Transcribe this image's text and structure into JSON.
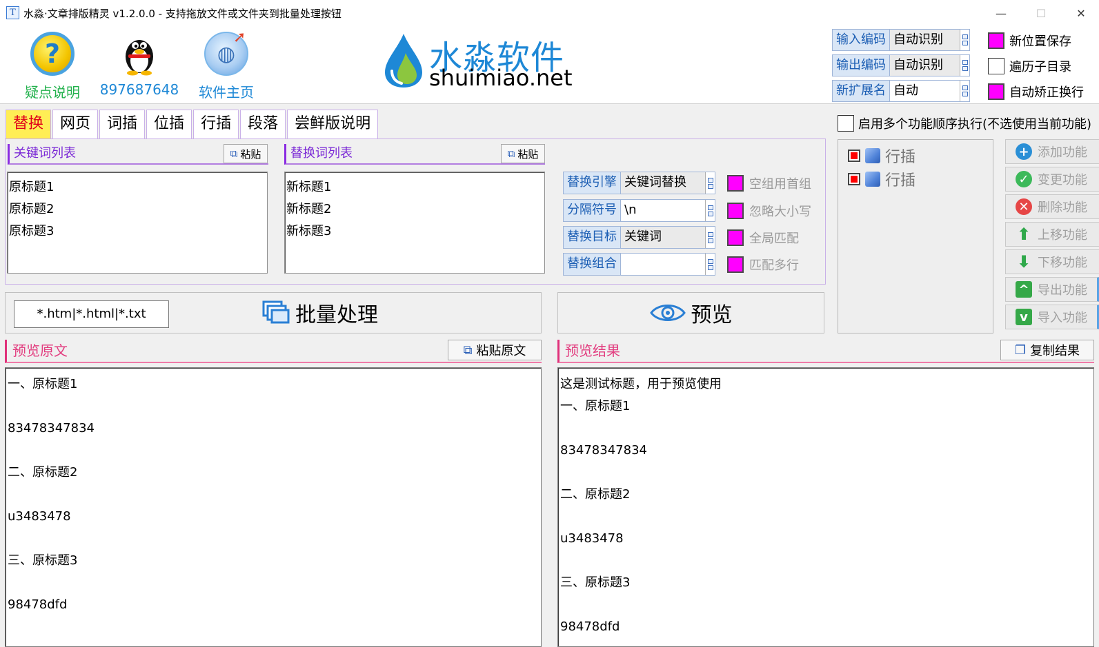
{
  "window": {
    "title": "水淼·文章排版精灵 v1.2.0.0 - 支持拖放文件或文件夹到批量处理按钮",
    "app_icon_char": "T",
    "minimize": "—",
    "maximize": "☐",
    "close": "✕"
  },
  "header": {
    "links": [
      {
        "label": "疑点说明",
        "color": "#22b14c"
      },
      {
        "label": "897687648",
        "color": "#1e88d6"
      },
      {
        "label": "软件主页",
        "color": "#1e88d6"
      }
    ],
    "logo_cn": "水淼软件",
    "logo_en": "shuimiao.net",
    "encodings": [
      {
        "label": "输入编码",
        "value": "自动识别"
      },
      {
        "label": "输出编码",
        "value": "自动识别"
      },
      {
        "label": "新扩展名",
        "value": "自动"
      }
    ],
    "options": [
      {
        "label": "新位置保存",
        "checked": true
      },
      {
        "label": "遍历子目录",
        "checked": false
      },
      {
        "label": "自动矫正换行",
        "checked": true
      }
    ]
  },
  "tabs": [
    "替换",
    "网页",
    "词插",
    "位插",
    "行插",
    "段落",
    "尝鲜版说明"
  ],
  "replace_panel": {
    "keyword_list_title": "关键词列表",
    "replace_list_title": "替换词列表",
    "paste_label": "粘贴",
    "keywords": [
      "原标题1",
      "原标题2",
      "原标题3"
    ],
    "replacements": [
      "新标题1",
      "新标题2",
      "新标题3"
    ],
    "settings": [
      {
        "label": "替换引擎",
        "value": "关键词替换"
      },
      {
        "label": "分隔符号",
        "value": "\\n"
      },
      {
        "label": "替换目标",
        "value": "关键词"
      },
      {
        "label": "替换组合",
        "value": ""
      }
    ],
    "flags": [
      "空组用首组",
      "忽略大小写",
      "全局匹配",
      "匹配多行"
    ]
  },
  "function_panel": {
    "enable_label": "启用多个功能顺序执行(不选使用当前功能)",
    "items": [
      "行插",
      "行插"
    ],
    "buttons": [
      {
        "label": "添加功能",
        "icon": "plus-icon",
        "color": "#2a8fd6",
        "glyph": "+"
      },
      {
        "label": "变更功能",
        "icon": "check-icon",
        "color": "#3cb95a",
        "glyph": "✓"
      },
      {
        "label": "删除功能",
        "icon": "delete-icon",
        "color": "#e64646",
        "glyph": "✕"
      },
      {
        "label": "上移功能",
        "icon": "arrow-up-icon",
        "color": "#2fa84a",
        "glyph": "⬆"
      },
      {
        "label": "下移功能",
        "icon": "arrow-down-icon",
        "color": "#2fa84a",
        "glyph": "⬇"
      },
      {
        "label": "导出功能",
        "icon": "export-icon",
        "color": "#35a848",
        "glyph": "^"
      },
      {
        "label": "导入功能",
        "icon": "import-icon",
        "color": "#35a848",
        "glyph": "v"
      }
    ]
  },
  "batch": {
    "extensions": "*.htm|*.html|*.txt",
    "label": "批量处理"
  },
  "preview_button": "预览",
  "source": {
    "title": "预览原文",
    "paste_label": "粘贴原文",
    "lines": [
      "一、原标题1",
      "",
      "83478347834",
      "",
      "二、原标题2",
      "",
      "u3483478",
      "",
      "三、原标题3",
      "",
      "98478dfd",
      ""
    ]
  },
  "result": {
    "title": "预览结果",
    "copy_label": "复制结果",
    "lines": [
      "这是测试标题，用于预览使用",
      "一、原标题1",
      "",
      "83478347834",
      "",
      "二、原标题2",
      "",
      "u3483478",
      "",
      "三、原标题3",
      "",
      "98478dfd"
    ]
  }
}
